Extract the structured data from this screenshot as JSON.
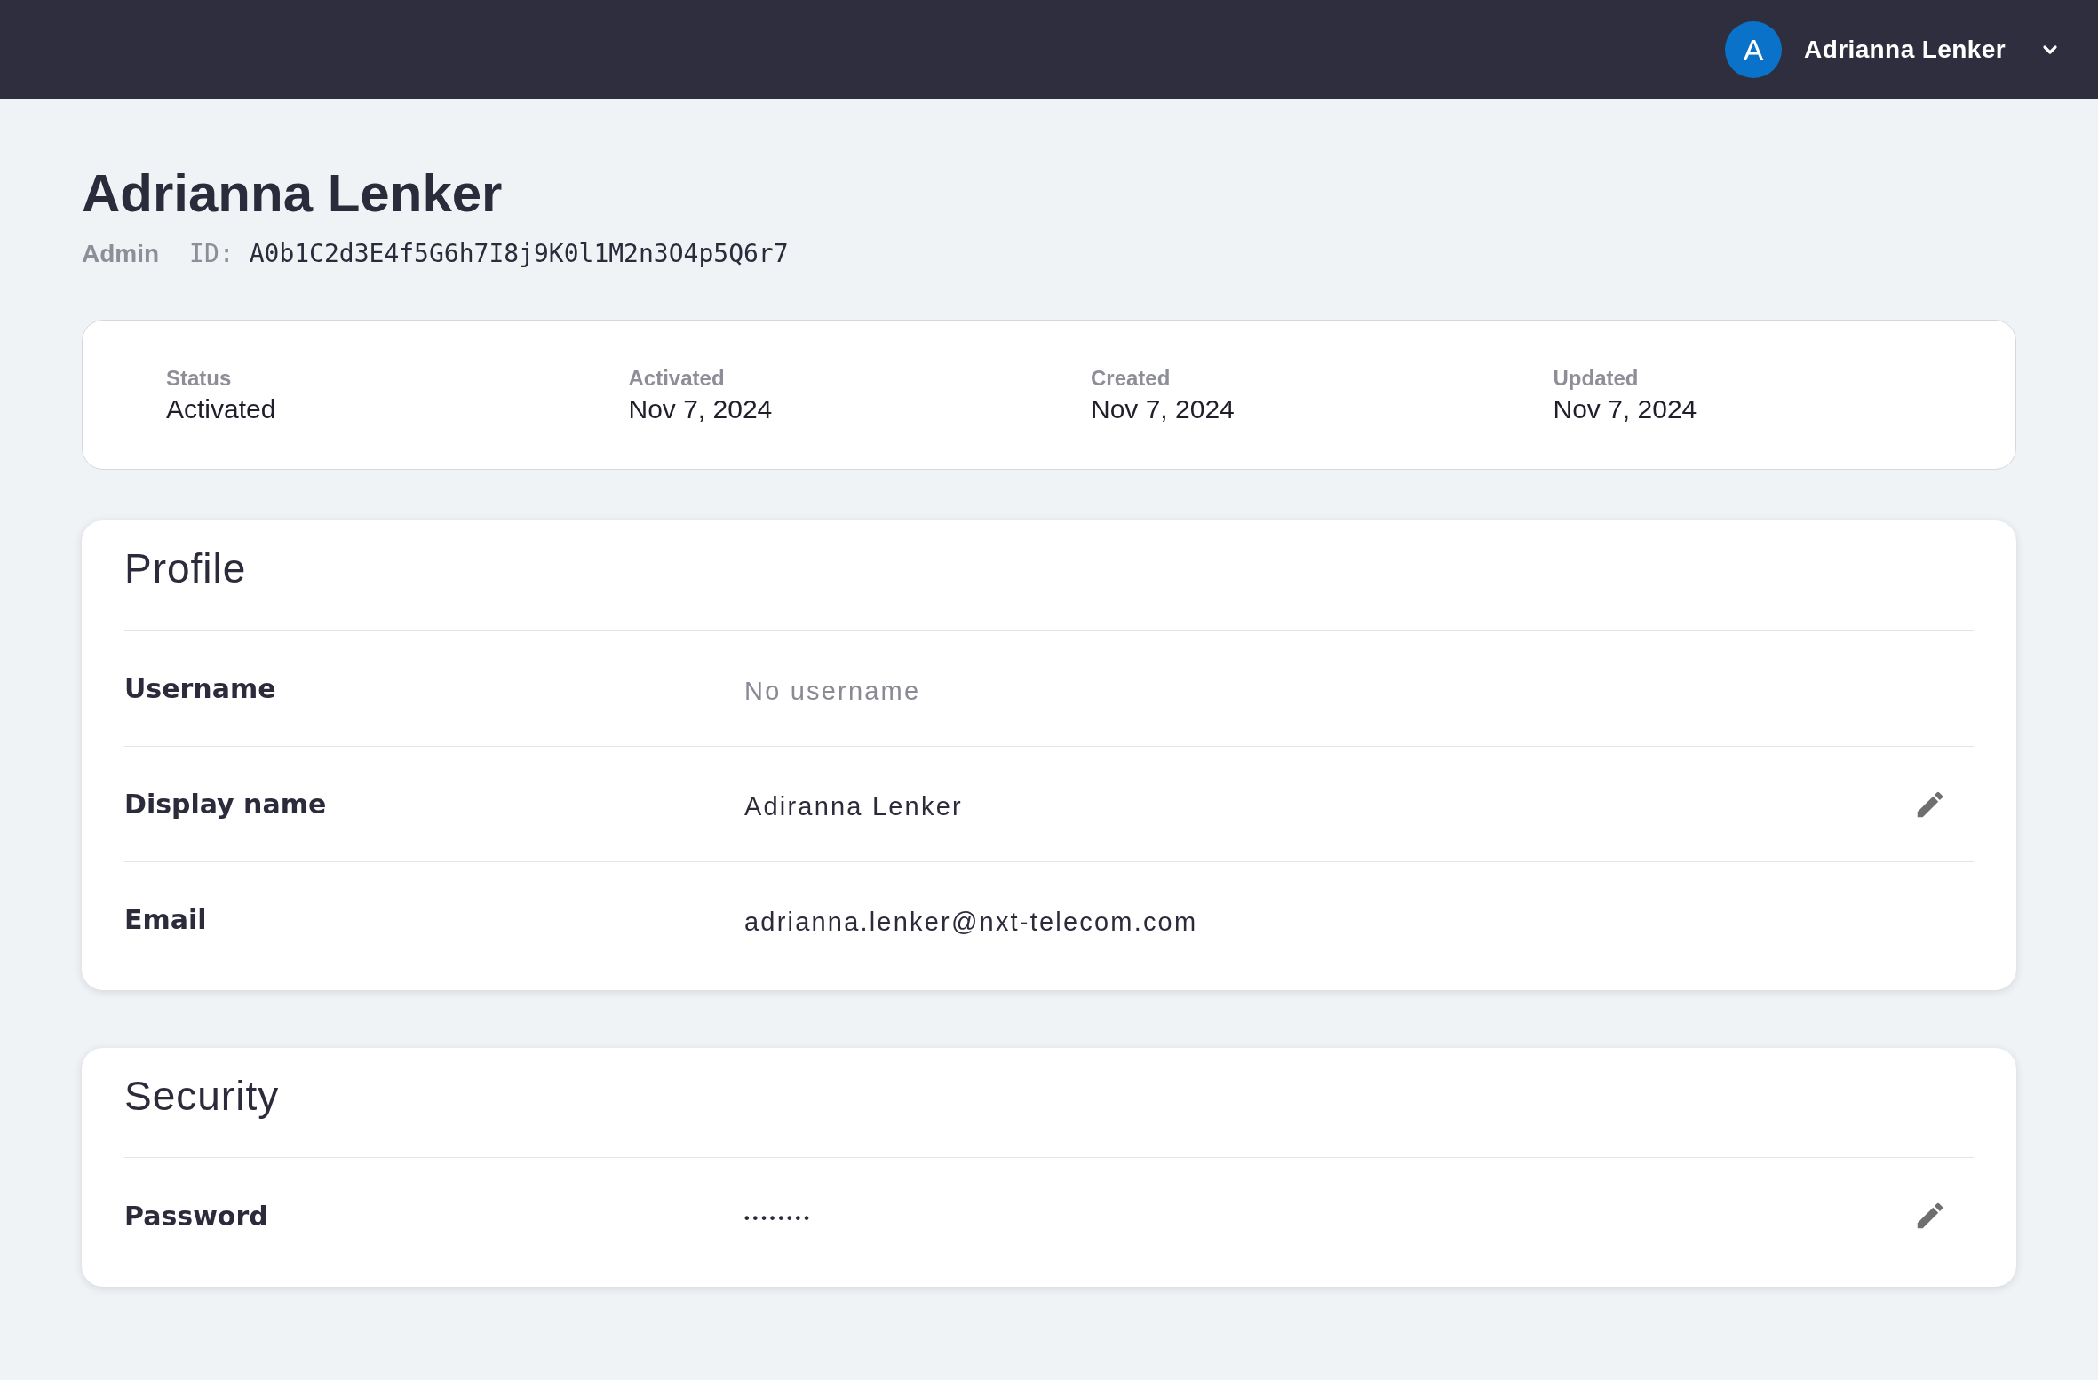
{
  "top_bar": {
    "avatar_initial": "A",
    "user_name": "Adrianna Lenker"
  },
  "header": {
    "title": "Adrianna Lenker",
    "role": "Admin",
    "id_label": "ID:",
    "id_value": "A0b1C2d3E4f5G6h7I8j9K0l1M2n3O4p5Q6r7"
  },
  "summary": [
    {
      "label": "Status",
      "value": "Activated"
    },
    {
      "label": "Activated",
      "value": "Nov 7, 2024"
    },
    {
      "label": "Created",
      "value": "Nov 7, 2024"
    },
    {
      "label": "Updated",
      "value": "Nov 7, 2024"
    }
  ],
  "sections": [
    {
      "title": "Profile",
      "rows": [
        {
          "kind": "text",
          "label": "Username",
          "value": "No username",
          "empty": true,
          "editable": false
        },
        {
          "kind": "text",
          "label": "Display name",
          "value": "Adiranna Lenker",
          "empty": false,
          "editable": true
        },
        {
          "kind": "text",
          "label": "Email",
          "value": "adrianna.lenker@nxt-telecom.com",
          "empty": false,
          "editable": false
        }
      ]
    },
    {
      "title": "Security",
      "rows": [
        {
          "kind": "password",
          "label": "Password",
          "value": "••••••••",
          "empty": false,
          "editable": true
        }
      ]
    }
  ]
}
